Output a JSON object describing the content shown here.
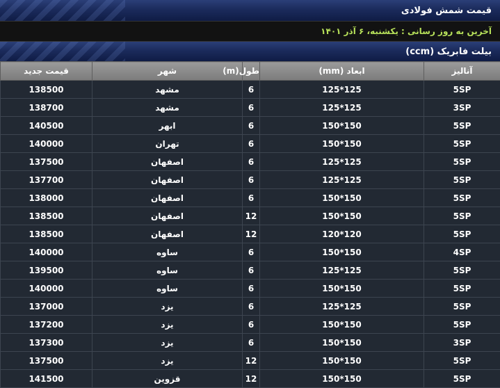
{
  "header": {
    "title": "قیمت شمش فولادی"
  },
  "update": {
    "text": "آخرین به روز رسانی : یکشنبه، ۶ آذر ۱۴۰۱"
  },
  "section": {
    "title": "بیلت فابریک (ccm)"
  },
  "table": {
    "columns": [
      "آنالیز",
      "ابعاد (mm)",
      "طول(m)",
      "شهر",
      "قیمت جدید"
    ],
    "rows": [
      [
        "5SP",
        "125*125",
        "6",
        "مشهد",
        "138500"
      ],
      [
        "3SP",
        "125*125",
        "6",
        "مشهد",
        "138700"
      ],
      [
        "5SP",
        "150*150",
        "6",
        "ابهر",
        "140500"
      ],
      [
        "5SP",
        "150*150",
        "6",
        "تهران",
        "140000"
      ],
      [
        "5SP",
        "125*125",
        "6",
        "اصفهان",
        "137500"
      ],
      [
        "5SP",
        "125*125",
        "6",
        "اصفهان",
        "137700"
      ],
      [
        "5SP",
        "150*150",
        "6",
        "اصفهان",
        "138000"
      ],
      [
        "5SP",
        "150*150",
        "12",
        "اصفهان",
        "138500"
      ],
      [
        "5SP",
        "120*120",
        "12",
        "اصفهان",
        "138500"
      ],
      [
        "4SP",
        "150*150",
        "6",
        "ساوه",
        "140000"
      ],
      [
        "5SP",
        "125*125",
        "6",
        "ساوه",
        "139500"
      ],
      [
        "5SP",
        "150*150",
        "6",
        "ساوه",
        "140000"
      ],
      [
        "5SP",
        "125*125",
        "6",
        "یزد",
        "137000"
      ],
      [
        "5SP",
        "150*150",
        "6",
        "یزد",
        "137200"
      ],
      [
        "3SP",
        "150*150",
        "6",
        "یزد",
        "137300"
      ],
      [
        "5SP",
        "150*150",
        "12",
        "یزد",
        "137500"
      ],
      [
        "5SP",
        "150*150",
        "12",
        "قزوین",
        "141500"
      ]
    ]
  }
}
